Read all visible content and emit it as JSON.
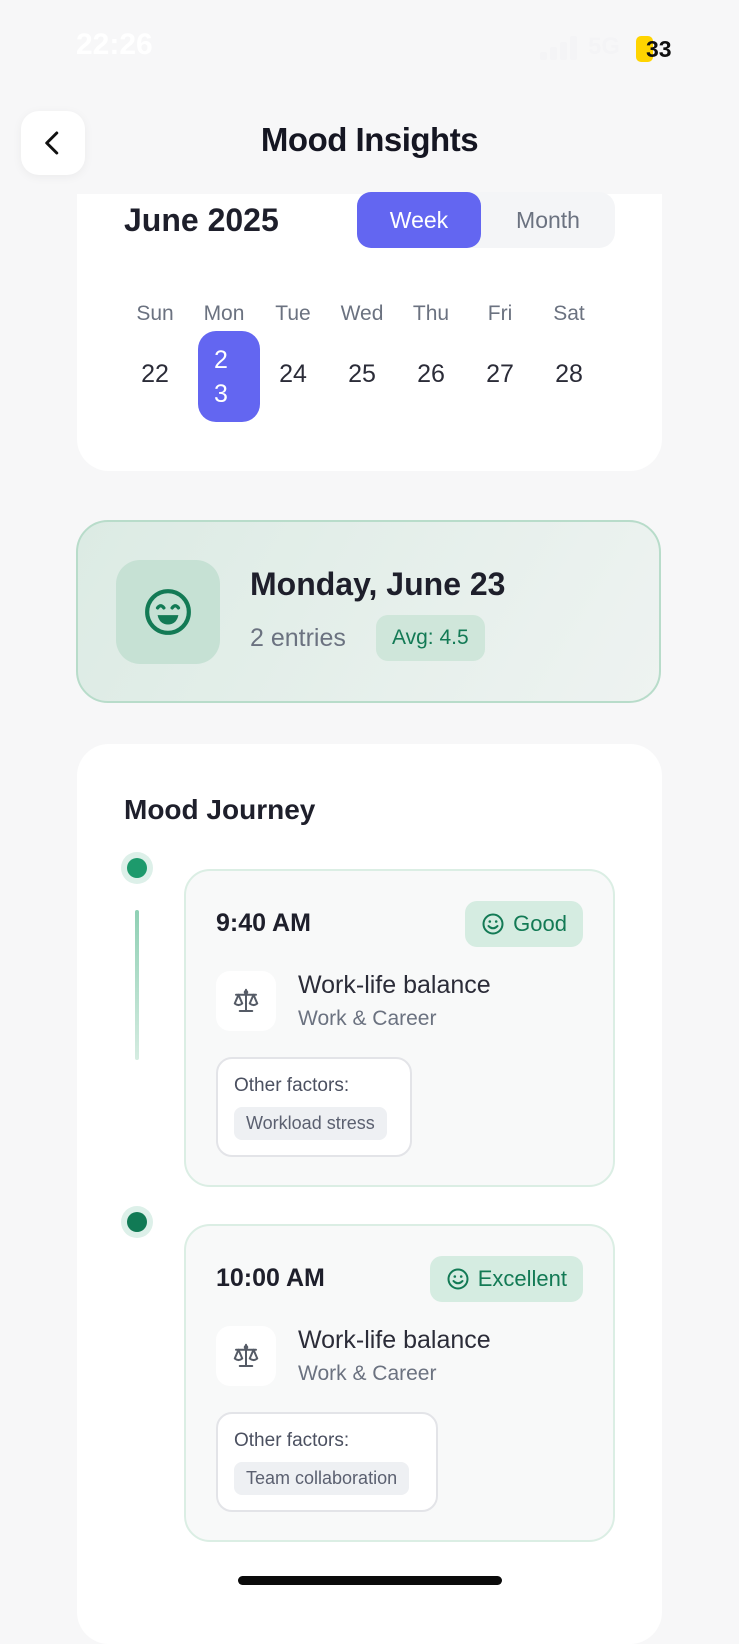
{
  "status_bar": {
    "time": "22:26",
    "network": "5G",
    "battery": "33"
  },
  "header": {
    "title": "Mood Insights",
    "back_icon": "chevron-left-icon"
  },
  "calendar": {
    "month_label": "June 2025",
    "view_toggle": {
      "week": "Week",
      "month": "Month",
      "selected": "Week"
    },
    "weekdays": [
      "Sun",
      "Mon",
      "Tue",
      "Wed",
      "Thu",
      "Fri",
      "Sat"
    ],
    "dates": [
      "22",
      "23",
      "24",
      "25",
      "26",
      "27",
      "28"
    ],
    "selected_date": "23",
    "accent_color": "#6366f1"
  },
  "day_summary": {
    "icon": "grin-face-icon",
    "title": "Monday, June 23",
    "entries": "2 entries",
    "average": "Avg: 4.5"
  },
  "journey": {
    "title": "Mood Journey",
    "entries": [
      {
        "time": "9:40 AM",
        "mood": "Good",
        "mood_icon": "smile-icon",
        "category_icon": "balance-scale-icon",
        "category": "Work-life balance",
        "subcategory": "Work & Career",
        "factors_label": "Other factors:",
        "factor": "Workload stress"
      },
      {
        "time": "10:00 AM",
        "mood": "Excellent",
        "mood_icon": "smile-icon",
        "category_icon": "balance-scale-icon",
        "category": "Work-life balance",
        "subcategory": "Work & Career",
        "factors_label": "Other factors:",
        "factor": "Team collaboration"
      }
    ],
    "accent_color": "#1d9a6c"
  }
}
